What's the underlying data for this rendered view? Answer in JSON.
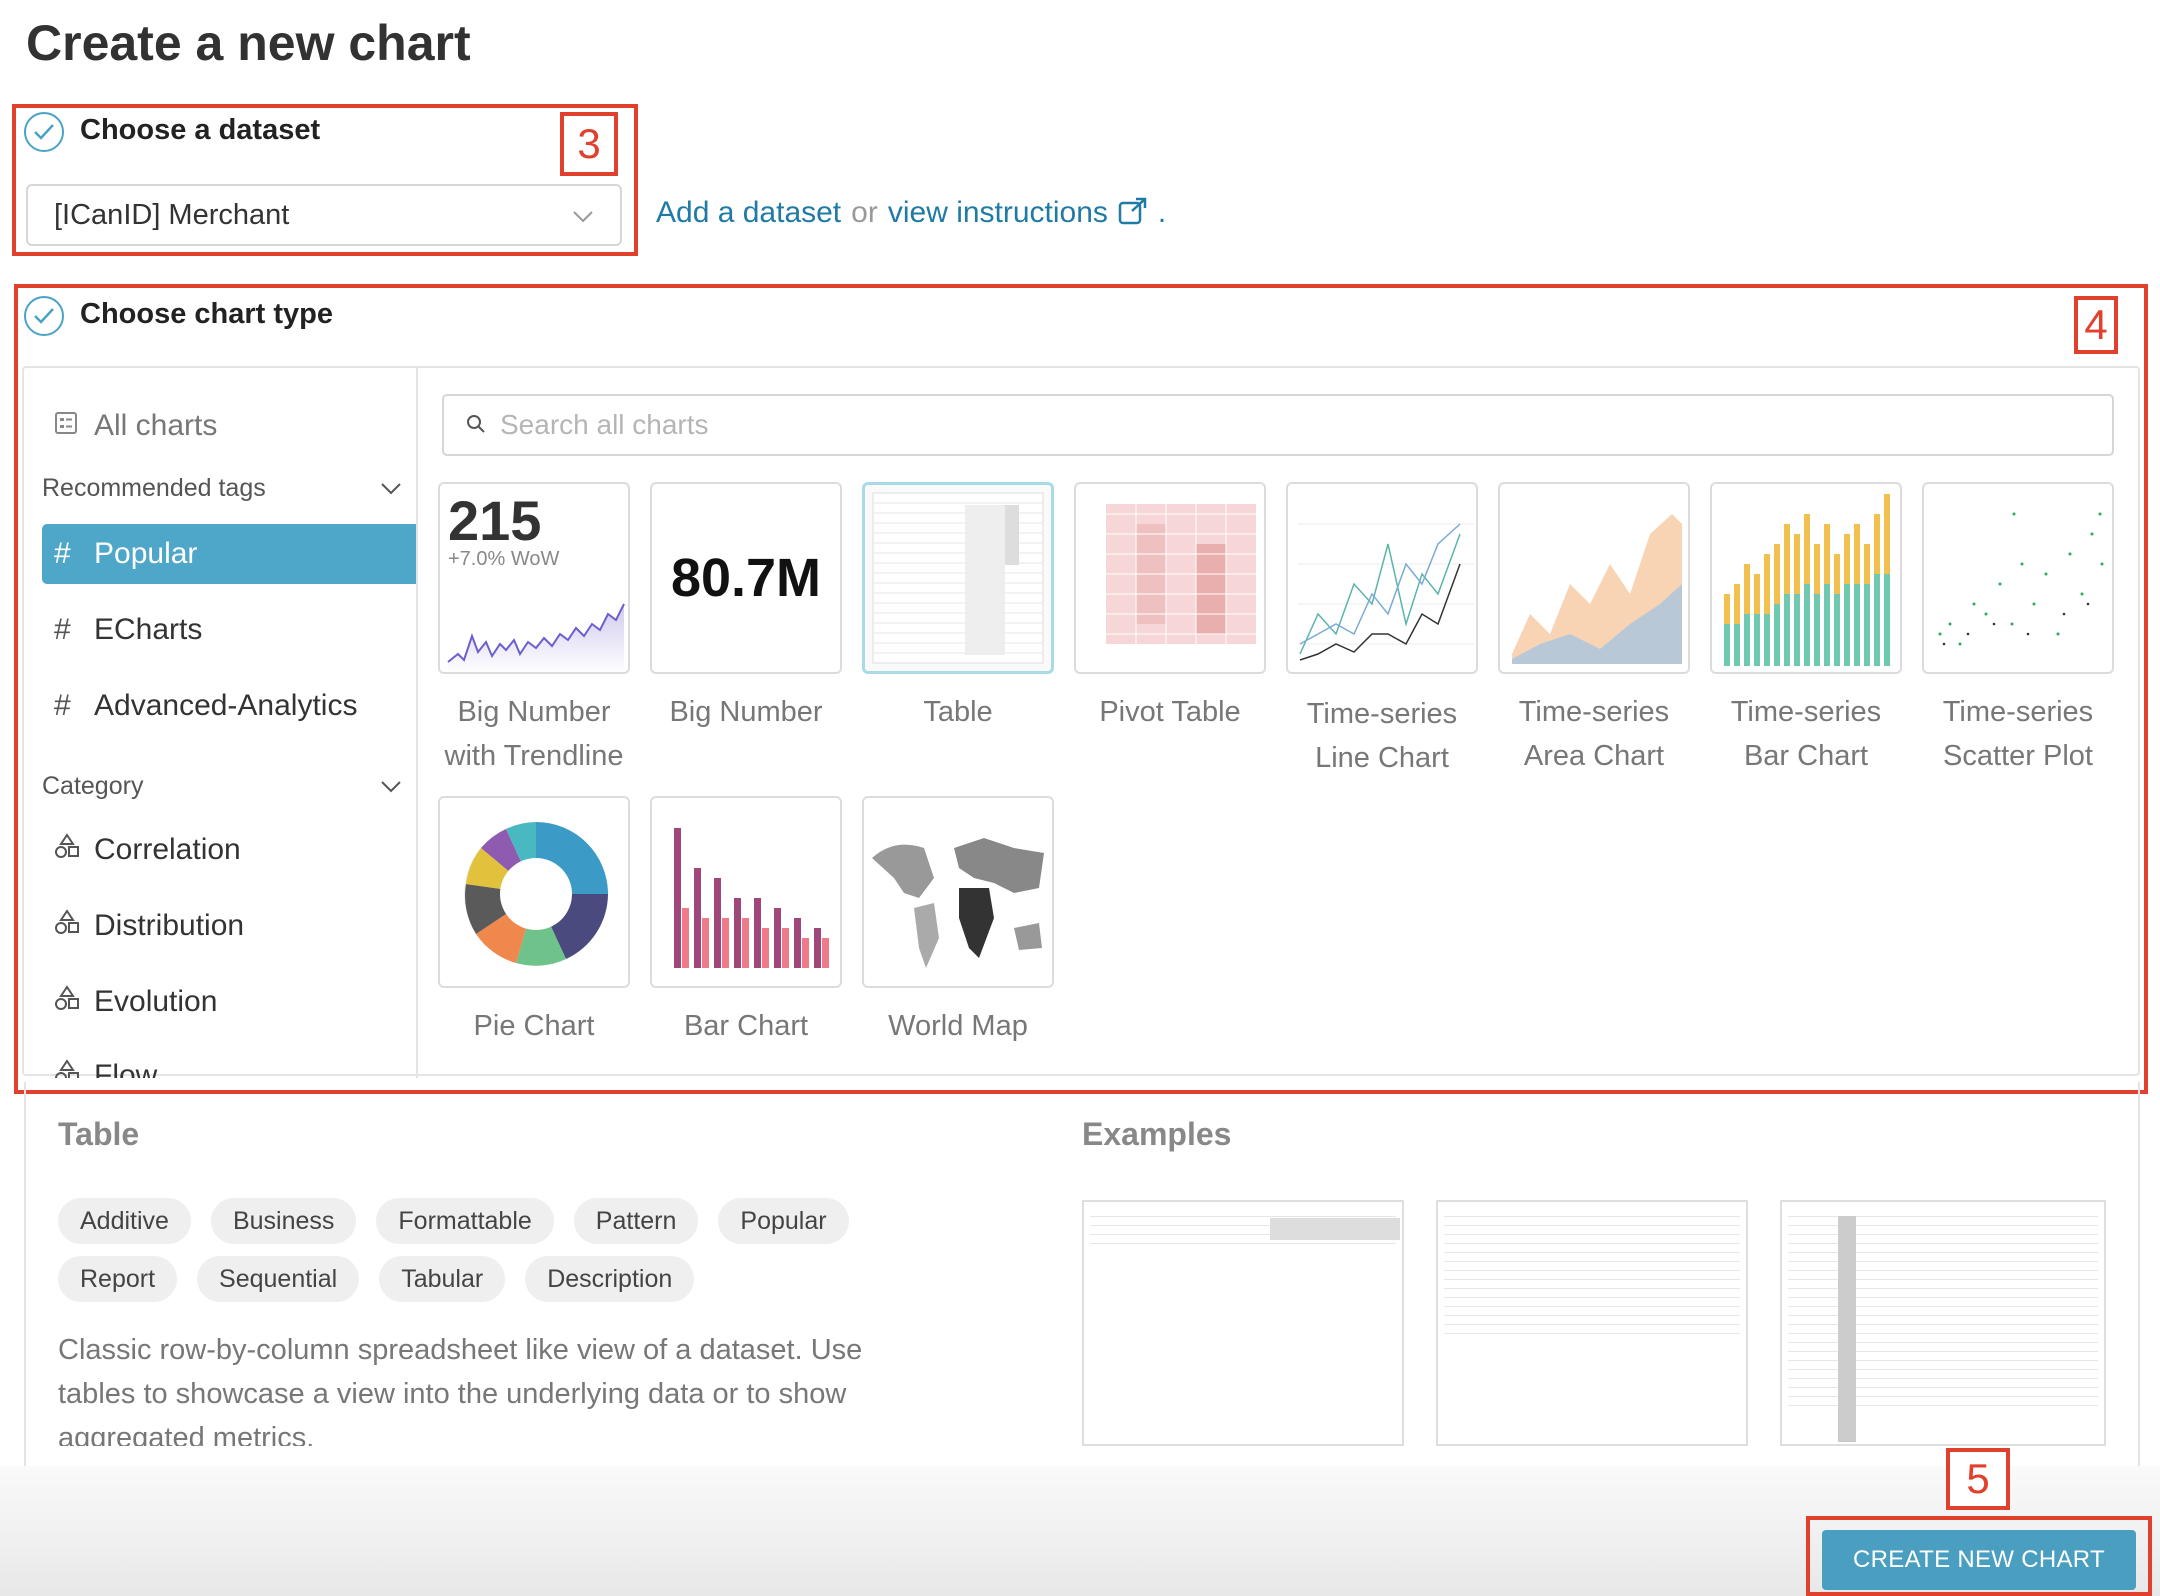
{
  "page_title": "Create a new chart",
  "dataset": {
    "step_label": "Choose a dataset",
    "selected": "[ICanID] Merchant",
    "add_link": "Add a dataset",
    "or_text": "or",
    "instructions_link": "view instructions",
    "period": "."
  },
  "chart_type": {
    "step_label": "Choose chart type",
    "search_placeholder": "Search all charts",
    "sidebar": {
      "all_charts": "All charts",
      "recommended_tags_label": "Recommended tags",
      "tags": [
        "Popular",
        "ECharts",
        "Advanced-Analytics"
      ],
      "category_label": "Category",
      "categories": [
        "Correlation",
        "Distribution",
        "Evolution",
        "Flow"
      ]
    },
    "tiles": [
      {
        "line1": "Big Number",
        "line2": "with Trendline"
      },
      {
        "line1": "Big Number",
        "line2": ""
      },
      {
        "line1": "Table",
        "line2": ""
      },
      {
        "line1": "Pivot Table",
        "line2": ""
      },
      {
        "line1": "Time-series",
        "line2": "Line Chart"
      },
      {
        "line1": "Time-series",
        "line2": "Area Chart"
      },
      {
        "line1": "Time-series",
        "line2": "Bar Chart"
      },
      {
        "line1": "Time-series",
        "line2": "Scatter Plot"
      },
      {
        "line1": "Pie Chart",
        "line2": ""
      },
      {
        "line1": "Bar Chart",
        "line2": ""
      },
      {
        "line1": "World Map",
        "line2": ""
      }
    ],
    "big_number_trend": {
      "value": "215",
      "delta": "+7.0% WoW"
    },
    "big_number": {
      "value": "80.7M"
    }
  },
  "details": {
    "title": "Table",
    "examples_label": "Examples",
    "tags": [
      "Additive",
      "Business",
      "Formattable",
      "Pattern",
      "Popular",
      "Report",
      "Sequential",
      "Tabular",
      "Description"
    ],
    "description": "Classic row-by-column spreadsheet like view of a dataset. Use tables to showcase a view into the underlying data or to show aggregated metrics."
  },
  "annotations": {
    "box3": "3",
    "box4": "4",
    "box5": "5"
  },
  "create_button": "CREATE NEW CHART",
  "colors": {
    "accent": "#4ea6c8",
    "link": "#1f7aa6",
    "annotation": "#e0402c"
  }
}
